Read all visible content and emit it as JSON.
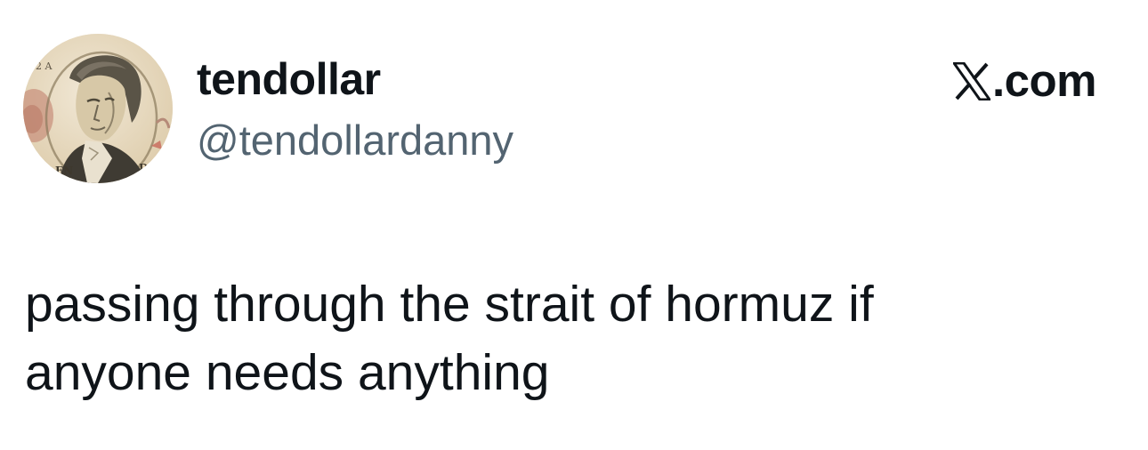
{
  "author": {
    "display_name": "tendollar",
    "handle": "@tendollardanny",
    "avatar_icon": "ten-dollar-bill-portrait-icon"
  },
  "brand": {
    "logo_icon": "x-logo-icon",
    "text": ".com"
  },
  "tweet": {
    "lines": [
      "passing through the strait of hormuz if",
      "anyone needs anything"
    ]
  },
  "colors": {
    "background": "#ffffff",
    "primary_text": "#0f1419",
    "secondary_text": "#536471"
  }
}
